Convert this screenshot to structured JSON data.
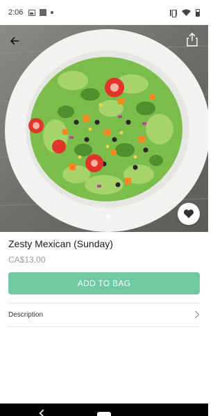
{
  "status_bar": {
    "time": "2:06",
    "left_icons": [
      "image-icon",
      "square-icon",
      "dot-icon"
    ],
    "right_icons": [
      "vibrate-icon",
      "wifi-icon",
      "battery-icon"
    ]
  },
  "hero": {
    "image_icon": "salad-photo",
    "back_icon": "arrow-left-icon",
    "share_icon": "share-icon",
    "favorite_icon": "heart-icon",
    "page_count": 2,
    "active_page": 1
  },
  "product": {
    "title": "Zesty Mexican (Sunday)",
    "price": "CA$13.00"
  },
  "actions": {
    "add_to_bag_label": "ADD TO BAG"
  },
  "description": {
    "label": "Description",
    "chevron_icon": "chevron-right-icon"
  },
  "colors": {
    "accent": "#6fc9a3",
    "price_text": "#9a9a9a",
    "nav_bar": "#000000"
  }
}
